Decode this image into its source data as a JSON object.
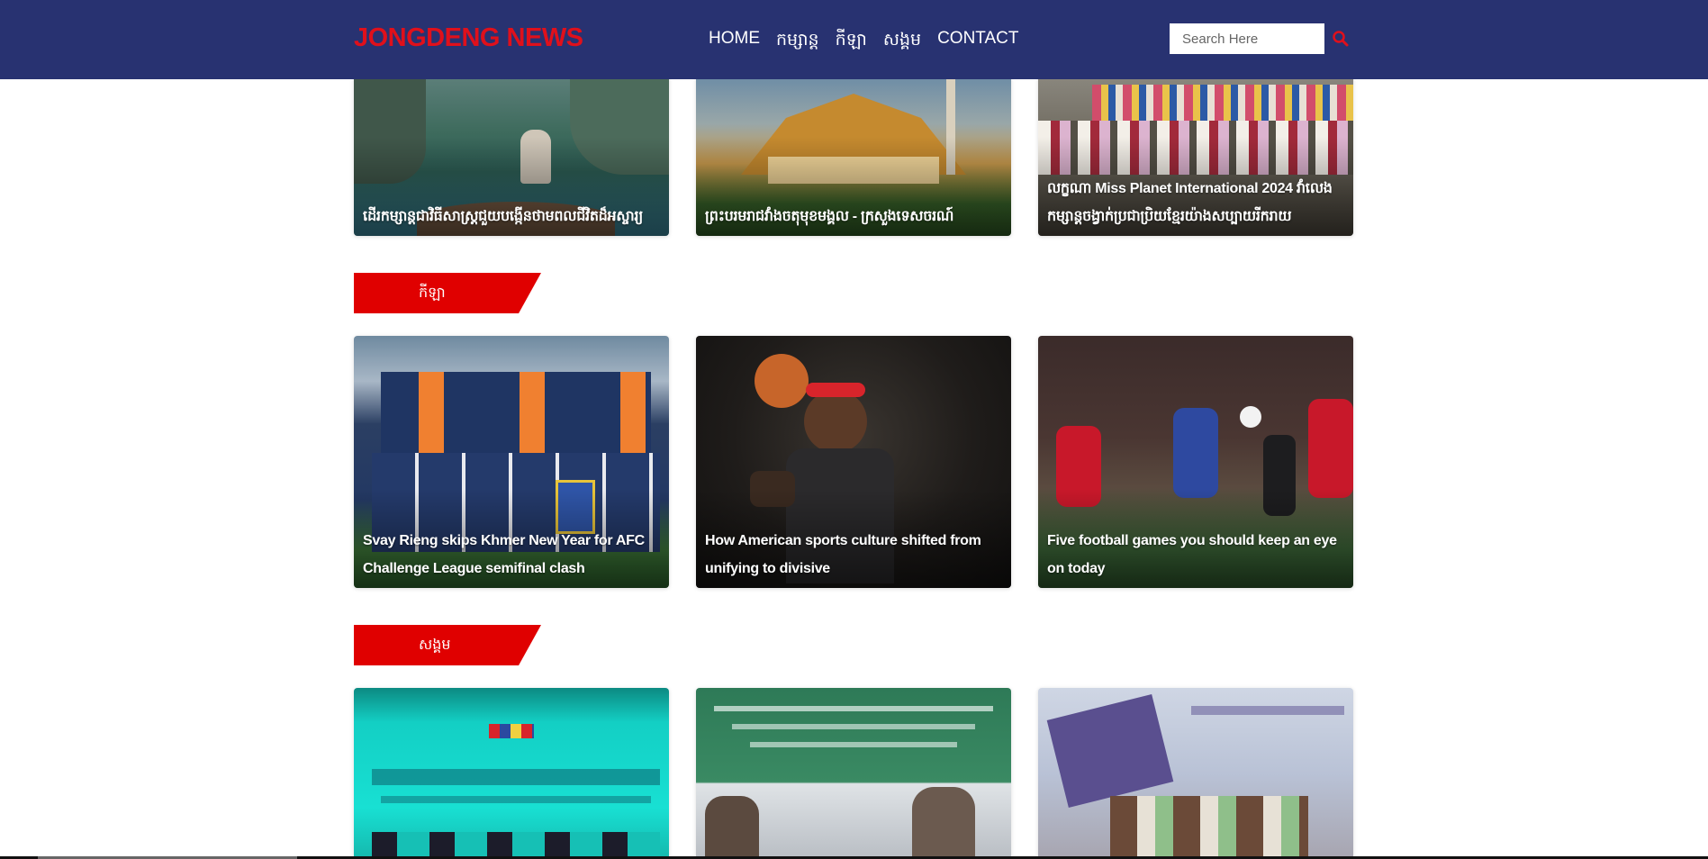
{
  "brand": "JONGDENG NEWS",
  "nav": [
    "HOME",
    "កម្សាន្ត",
    "កីឡា",
    "សង្គម",
    "CONTACT"
  ],
  "search": {
    "placeholder": "Search Here"
  },
  "top_row": [
    {
      "title": "ដើរកម្សាន្តជាវិធីសាស្រ្តជួយបង្កើនថាមពលជីវិតដ៏អស្ចារ្យ"
    },
    {
      "title": "ព្រះបរមរាជវាំងចតុមុខមង្គល - ក្រសួងទេសចរណ៍"
    },
    {
      "title": "លក្ខណា Miss Planet International 2024 វាំលេងកម្សាន្តចង្វាក់ប្រជាប្រិយខ្មែរយ៉ាងសប្បាយរីករាយ"
    }
  ],
  "sections": [
    {
      "label": "កីឡា",
      "cards": [
        {
          "title": "Svay Rieng skips Khmer New Year for AFC Challenge League semifinal clash"
        },
        {
          "title": "How American sports culture shifted from unifying to divisive"
        },
        {
          "title": "Five football games you should keep an eye on today"
        }
      ]
    },
    {
      "label": "សង្គម",
      "cards": [
        {},
        {},
        {}
      ]
    }
  ],
  "colors": {
    "navbar": "#283271",
    "brand": "#e0101b",
    "section_label": "#e00000"
  }
}
